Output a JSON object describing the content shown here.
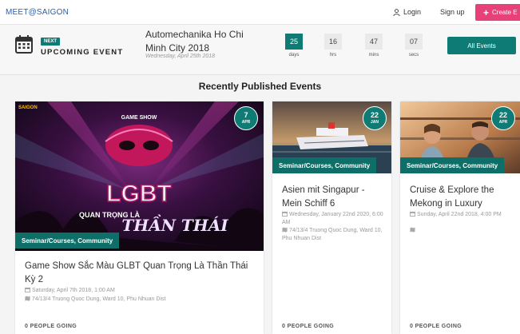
{
  "nav": {
    "brand": "MEET@SAIGON",
    "login": "Login",
    "signup": "Sign up",
    "create": "Create E"
  },
  "upcoming": {
    "badge": "NEXT",
    "label": "UPCOMING EVENT",
    "title": "Automechanika Ho Chi Minh City 2018",
    "date": "Wednesday, April 25th 2018",
    "countdown": [
      {
        "value": "25",
        "unit": "days"
      },
      {
        "value": "16",
        "unit": "hrs"
      },
      {
        "value": "47",
        "unit": "mins"
      },
      {
        "value": "07",
        "unit": "secs"
      }
    ],
    "all_events": "All Events"
  },
  "section": {
    "title": "Recently Published Events"
  },
  "cards": [
    {
      "day": "7",
      "month": "APR",
      "category": "Seminar/Courses, Community",
      "title": "Game Show Sắc Màu GLBT Quan Trọng Là Thần Thái Kỳ 2",
      "date": "Saturday, April 7th 2018, 1:00 AM",
      "address": "74/13/4 Truong Quoc Dung, Ward 10, Phu Nhuan Dist",
      "going": "0 PEOPLE GOING",
      "poster": {
        "show": "GAME SHOW",
        "big": "LGBT",
        "sub": "QUAN TRỌNG LÀ",
        "script": "THẦN THÁI",
        "logo": "SAIGON"
      }
    },
    {
      "day": "22",
      "month": "JAN",
      "category": "Seminar/Courses, Community",
      "title": "Asien mit Singapur - Mein Schiff 6",
      "date": "Wednesday, January 22nd 2020, 6:00 AM",
      "address": "74/13/4 Truong Quoc Dung, Ward 10, Phu Nhuan Dist",
      "going": "0 PEOPLE GOING"
    },
    {
      "day": "22",
      "month": "APR",
      "category": "Seminar/Courses, Community",
      "title": "Cruise & Explore the Mekong in Luxury",
      "date": "Sunday, April 22nd 2018, 4:00 PM",
      "address": "",
      "going": "0 PEOPLE GOING"
    }
  ]
}
